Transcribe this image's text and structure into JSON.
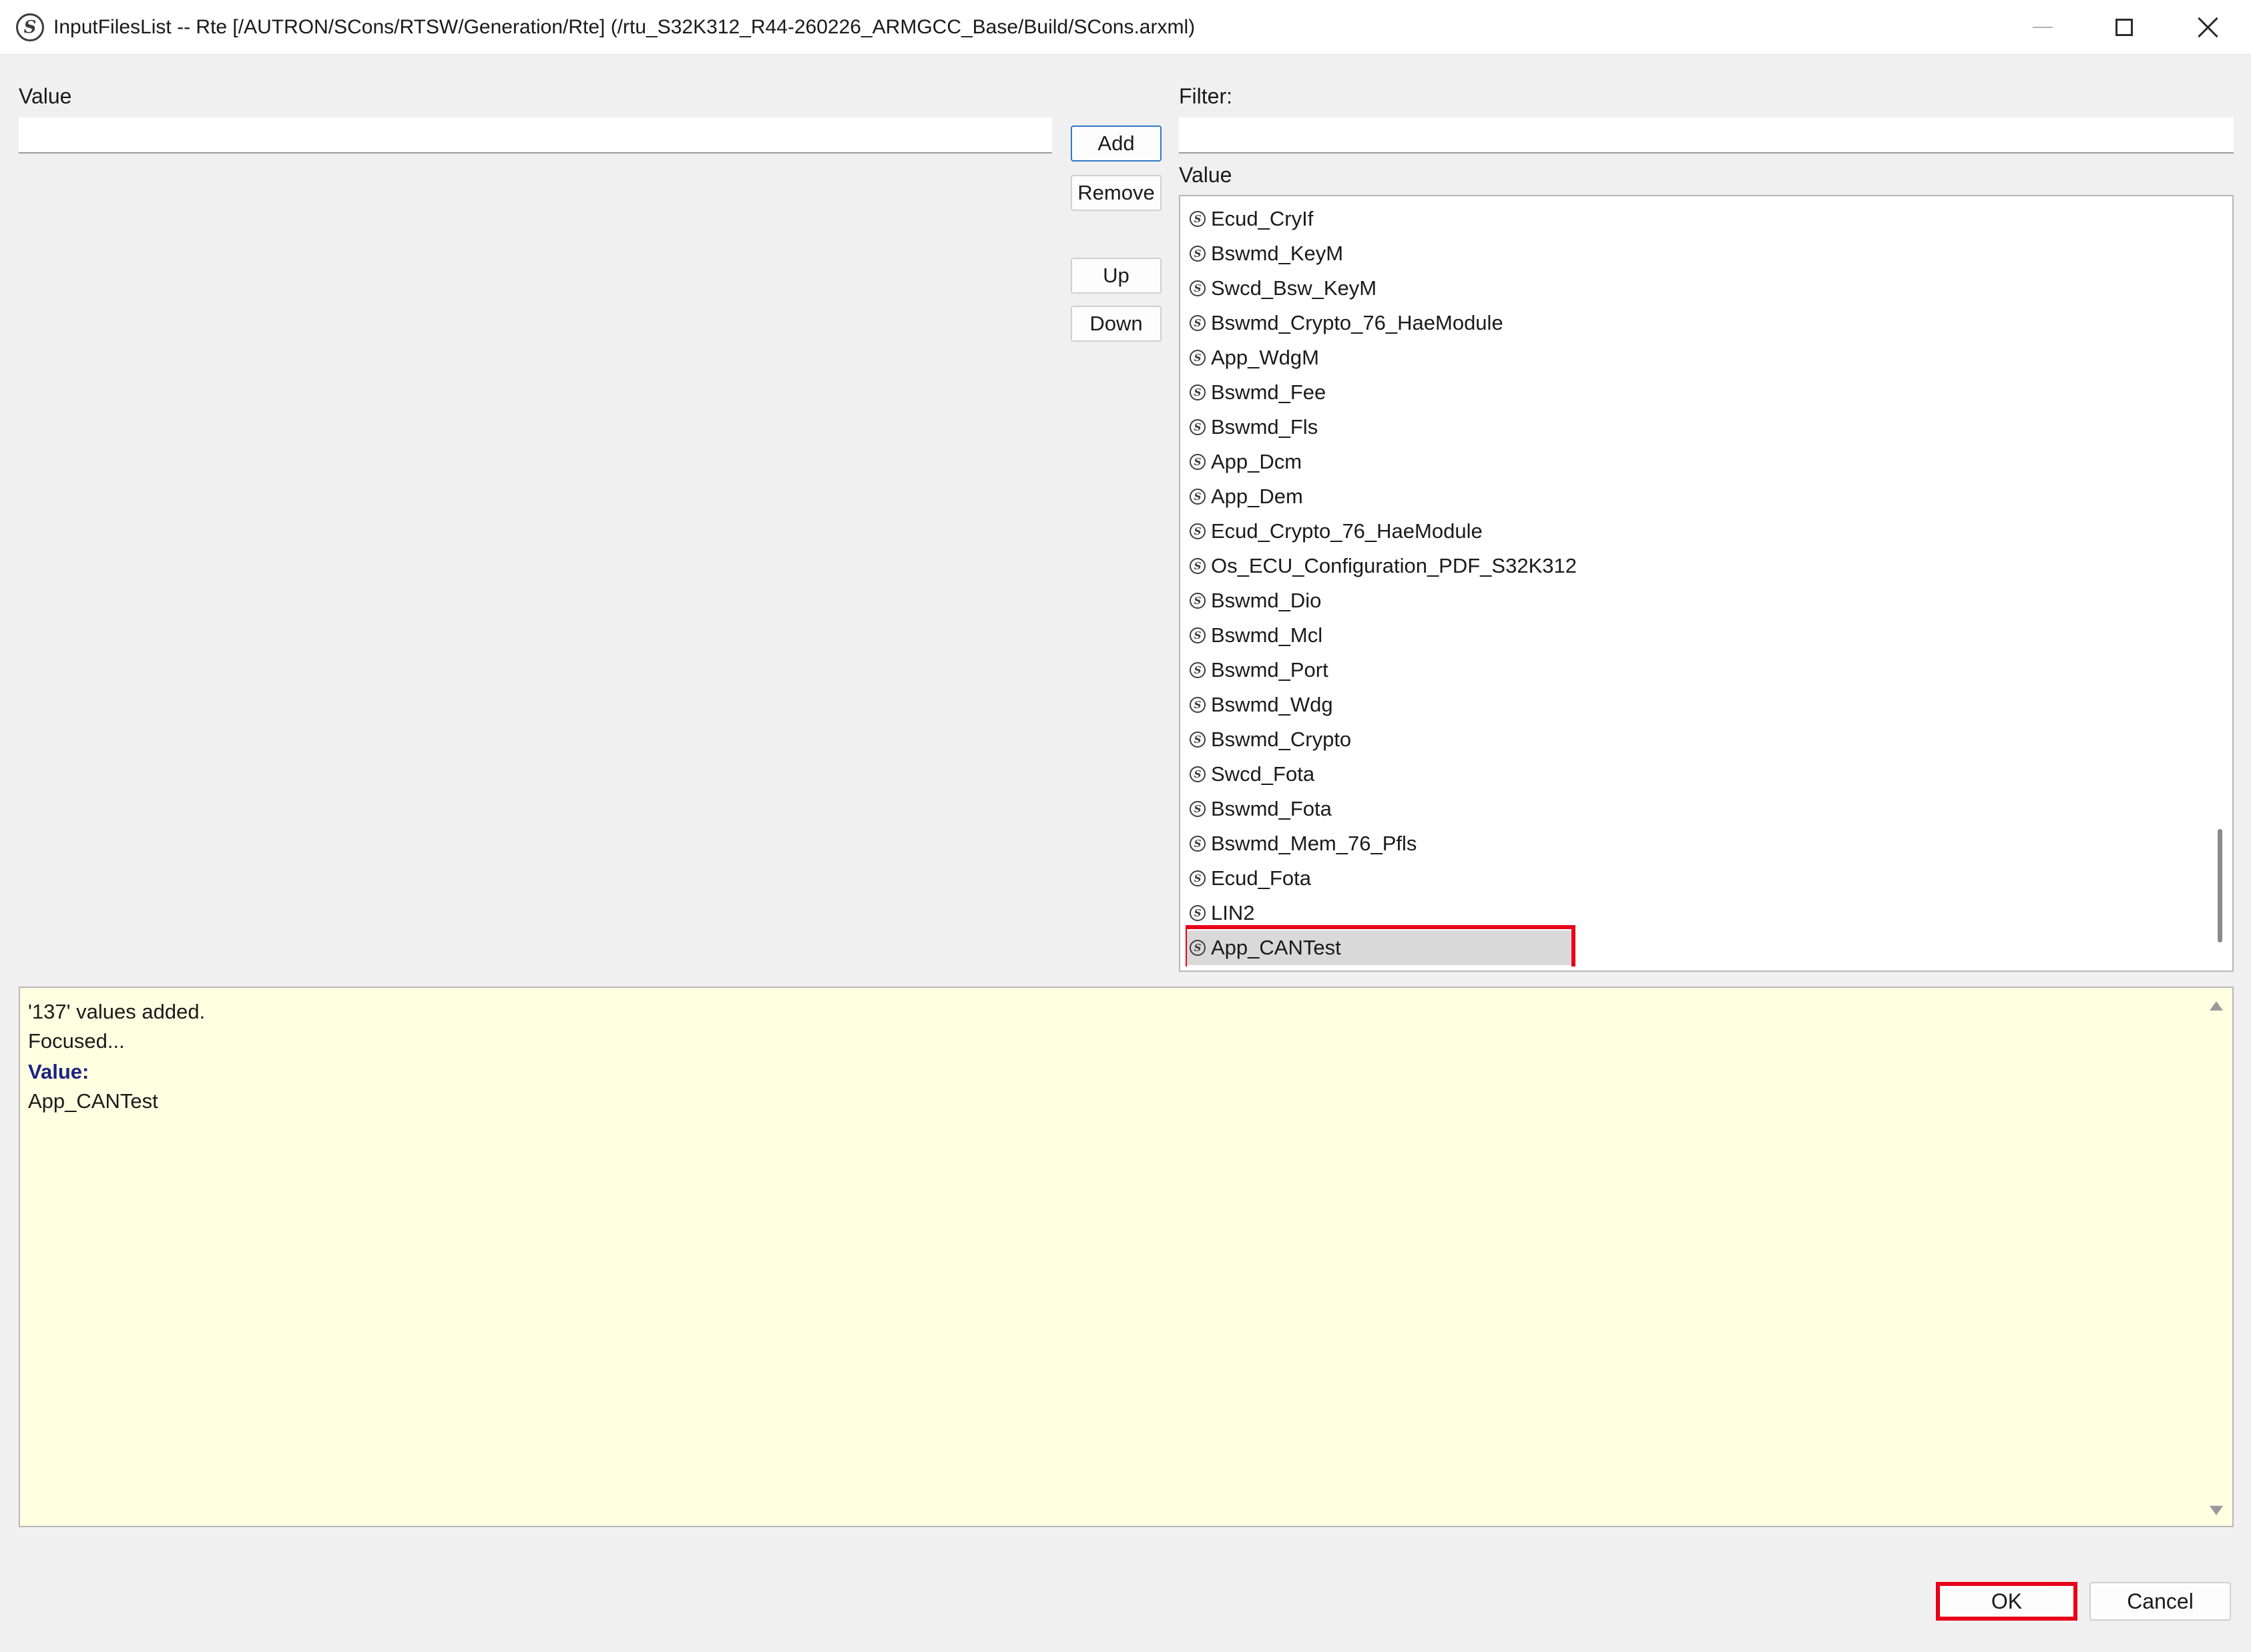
{
  "window": {
    "title": "InputFilesList -- Rte [/AUTRON/SCons/RTSW/Generation/Rte] (/rtu_S32K312_R44-260226_ARMGCC_Base/Build/SCons.arxml)",
    "app_icon_glyph": "S"
  },
  "left": {
    "value_label": "Value",
    "value_input": ""
  },
  "buttons": {
    "add": "Add",
    "remove": "Remove",
    "up": "Up",
    "down": "Down"
  },
  "right": {
    "filter_label": "Filter:",
    "filter_input": "",
    "list_header": "Value",
    "item_icon_glyph": "S",
    "items": [
      "Ecud_CryIf",
      "Bswmd_KeyM",
      "Swcd_Bsw_KeyM",
      "Bswmd_Crypto_76_HaeModule",
      "App_WdgM",
      "Bswmd_Fee",
      "Bswmd_Fls",
      "App_Dcm",
      "App_Dem",
      "Ecud_Crypto_76_HaeModule",
      "Os_ECU_Configuration_PDF_S32K312",
      "Bswmd_Dio",
      "Bswmd_Mcl",
      "Bswmd_Port",
      "Bswmd_Wdg",
      "Bswmd_Crypto",
      "Swcd_Fota",
      "Bswmd_Fota",
      "Bswmd_Mem_76_Pfls",
      "Ecud_Fota",
      "LIN2",
      "App_CANTest"
    ],
    "selected_index": 21
  },
  "info": {
    "line1": "'137' values added.",
    "line2": "Focused...",
    "line3": "Value:",
    "line4": "App_CANTest"
  },
  "footer": {
    "ok": "OK",
    "cancel": "Cancel"
  },
  "colors": {
    "highlight": "#e8001a",
    "info_background": "#ffffe2",
    "value_heading": "#1a237e",
    "primary_border": "#2f78c8"
  }
}
